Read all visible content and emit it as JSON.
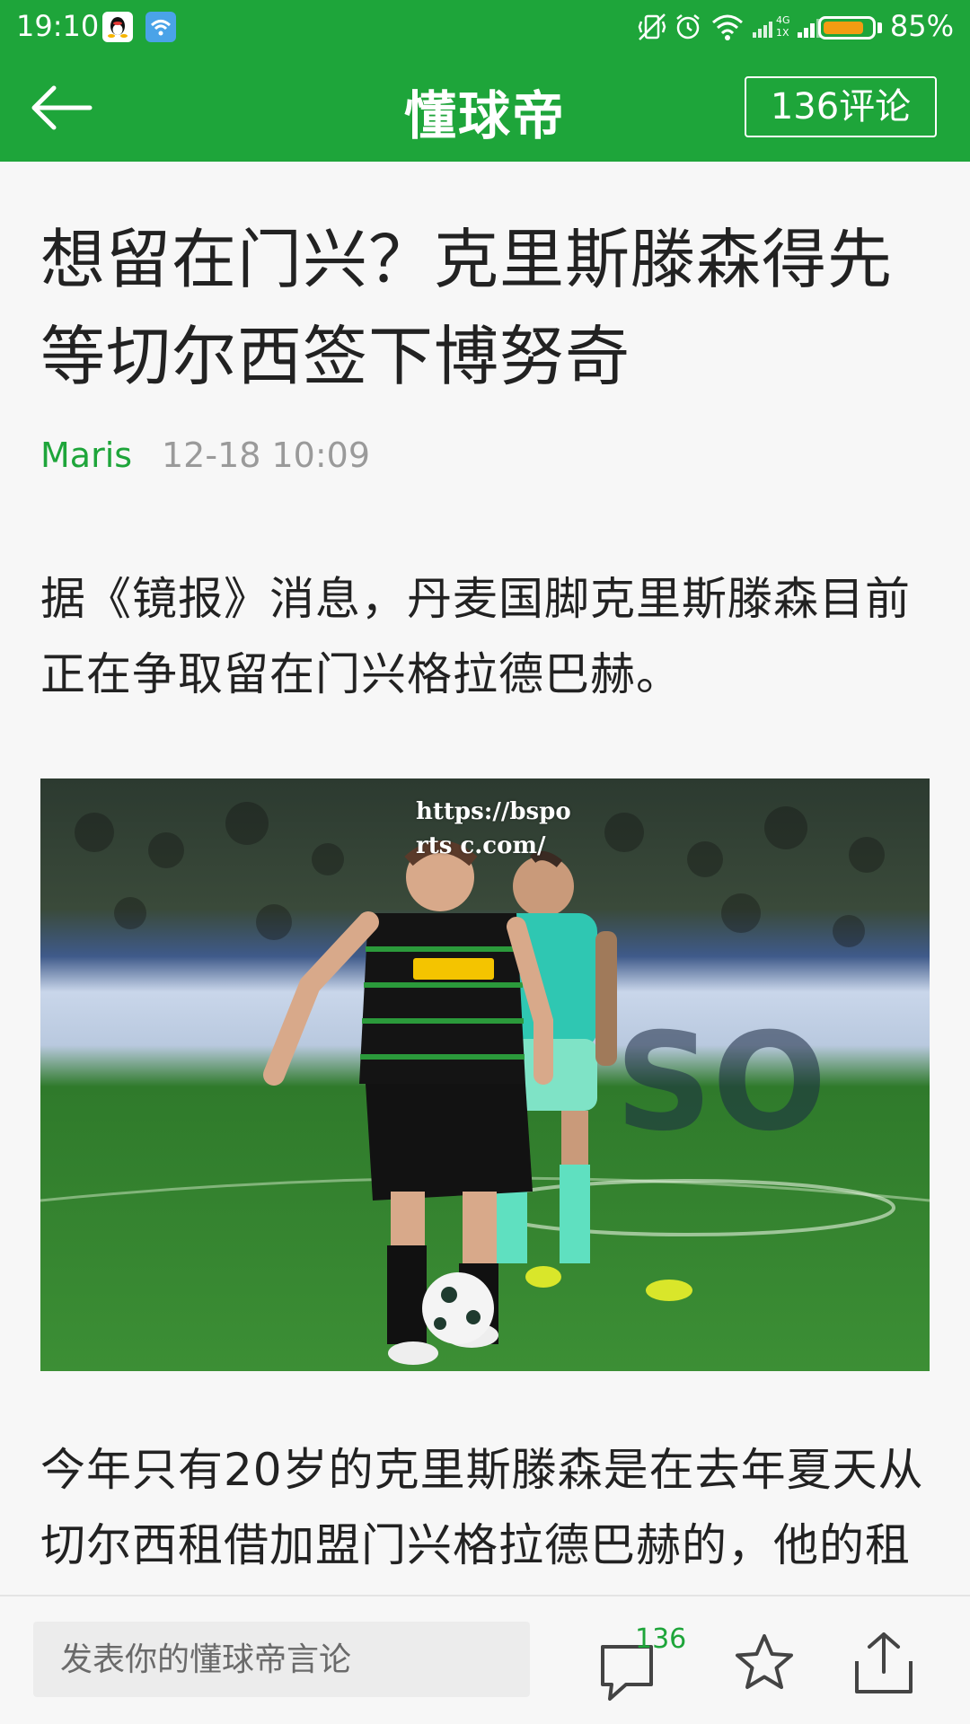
{
  "status_bar": {
    "time": "19:10",
    "battery_text": "85%",
    "battery_level": 0.85,
    "icons": [
      "qq-icon",
      "wifi-app-icon",
      "vibrate-icon",
      "alarm-icon",
      "wifi-icon",
      "signal-4g-icon",
      "signal-icon",
      "battery-icon"
    ]
  },
  "header": {
    "title": "懂球帝",
    "comments_label": "136评论"
  },
  "article": {
    "title": "想留在门兴？克里斯滕森得先等切尔西签下博努奇",
    "author": "Maris",
    "date": "12-18 10:09",
    "paragraph1": "据《镜报》消息，丹麦国脚克里斯滕森目前正在争取留在门兴格拉德巴赫。",
    "image_watermark": "https://bsports c.com/",
    "paragraph2": "今年只有20岁的克里斯滕森是在去年夏天从切尔西租借加盟门兴格拉德巴赫的，他的租"
  },
  "bottom_bar": {
    "comment_placeholder": "发表你的懂球帝言论",
    "comment_count": "136"
  },
  "colors": {
    "brand_green": "#1ea53a",
    "background": "#f7f7f7",
    "text": "#222222",
    "muted": "#9a9a9a"
  }
}
